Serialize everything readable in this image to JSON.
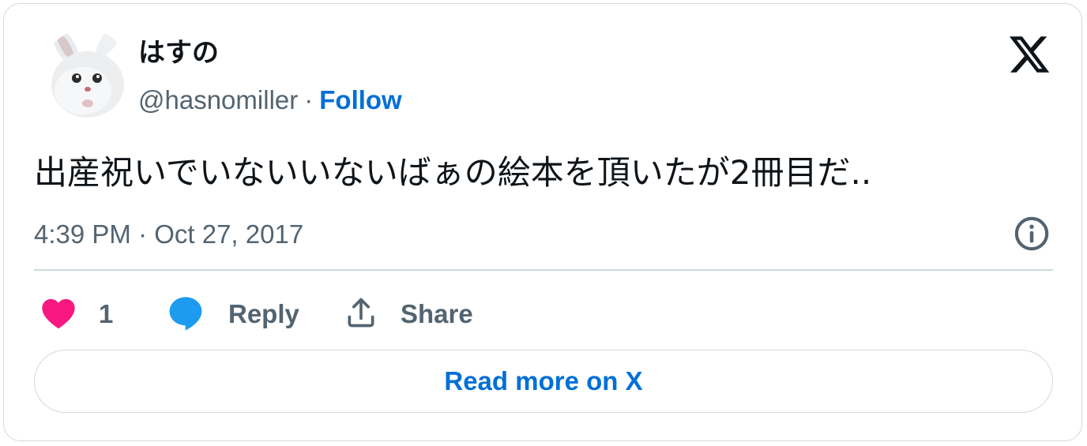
{
  "author": {
    "display_name": "はすの",
    "handle": "@hasnomiller",
    "separator": "·",
    "follow_label": "Follow",
    "avatar_icon": "white-rabbit-avatar"
  },
  "brand": {
    "logo_icon": "x-logo-icon",
    "color": "#0f1419"
  },
  "tweet": {
    "text": "出産祝いでいないいないばぁの絵本を頂いたが2冊目だ..",
    "timestamp": "4:39 PM · Oct 27, 2017",
    "info_icon": "info-icon"
  },
  "actions": {
    "like_count": "1",
    "like_icon": "heart-icon",
    "like_color": "#f91880",
    "reply_label": "Reply",
    "reply_icon": "speech-bubble-icon",
    "reply_color": "#1d9bf0",
    "share_label": "Share",
    "share_icon": "share-upload-icon"
  },
  "footer": {
    "read_more_label": "Read more on X",
    "link_color": "#006fd6"
  }
}
